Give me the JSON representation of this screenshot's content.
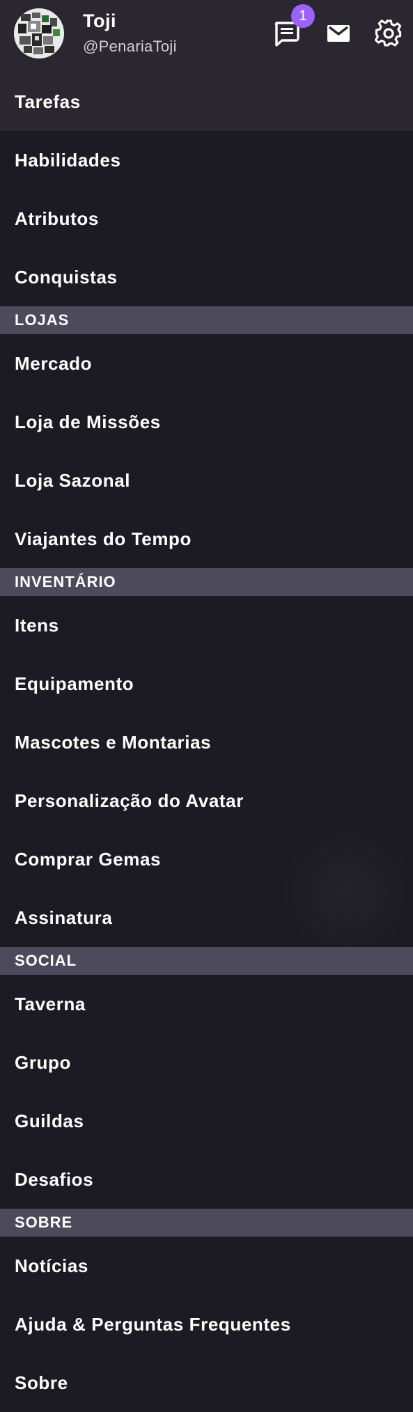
{
  "header": {
    "username": "Toji",
    "handle": "@PenariaToji",
    "notification_count": "1",
    "icons": [
      "chat-icon",
      "mail-icon",
      "gear-icon"
    ],
    "badge_color": "#9a62ff"
  },
  "menu": {
    "tarefas": "Tarefas",
    "habilidades": "Habilidades",
    "atributos": "Atributos",
    "conquistas": "Conquistas",
    "lojas_header": "LOJAS",
    "mercado": "Mercado",
    "loja_missoes": "Loja de Missões",
    "loja_sazonal": "Loja Sazonal",
    "viajantes": "Viajantes do Tempo",
    "inventario_header": "INVENTÁRIO",
    "itens": "Itens",
    "equipamento": "Equipamento",
    "mascotes": "Mascotes e Montarias",
    "personalizacao": "Personalização do Avatar",
    "gemas": "Comprar Gemas",
    "assinatura": "Assinatura",
    "social_header": "SOCIAL",
    "taverna": "Taverna",
    "grupo": "Grupo",
    "guildas": "Guildas",
    "desafios": "Desafios",
    "sobre_header": "SOBRE",
    "noticias": "Notícias",
    "ajuda": "Ajuda & Perguntas Frequentes",
    "sobre": "Sobre"
  },
  "colors": {
    "background": "#1c1a22",
    "header": "#2a2731",
    "section": "#4d4a5c"
  }
}
